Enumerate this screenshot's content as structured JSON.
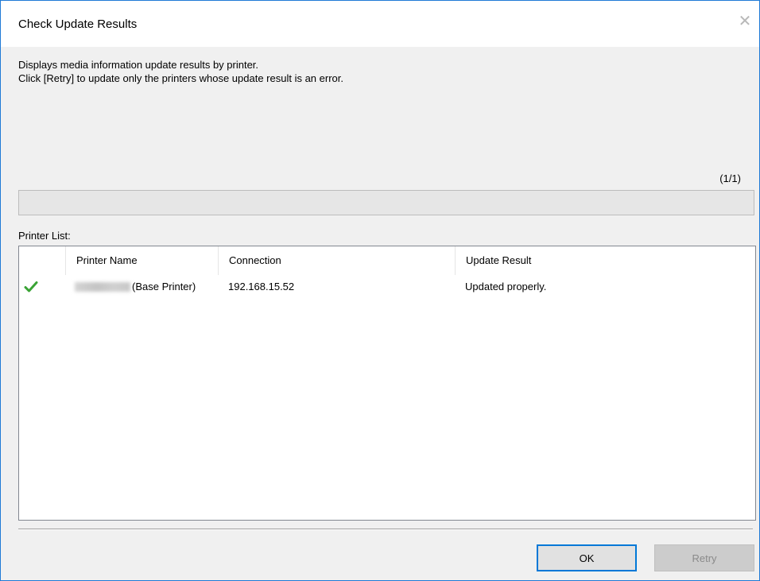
{
  "window": {
    "title": "Check Update Results",
    "close_glyph": "✕"
  },
  "description": {
    "line1": "Displays media information update results by printer.",
    "line2": "Click [Retry] to update only the printers whose update result is an error."
  },
  "progress": {
    "counter": "(1/1)",
    "fraction": 0
  },
  "printer_list": {
    "label": "Printer List:",
    "columns": [
      "",
      "Printer Name",
      "Connection",
      "Update Result"
    ],
    "rows": [
      {
        "status_icon": "checkmark-icon",
        "printer_name_suffix": "(Base Printer)",
        "connection": "192.168.15.52",
        "result": "Updated properly."
      }
    ]
  },
  "buttons": {
    "ok_label": "OK",
    "retry_label": "Retry"
  },
  "colors": {
    "check": "#3aa335",
    "accent": "#0078d7"
  }
}
